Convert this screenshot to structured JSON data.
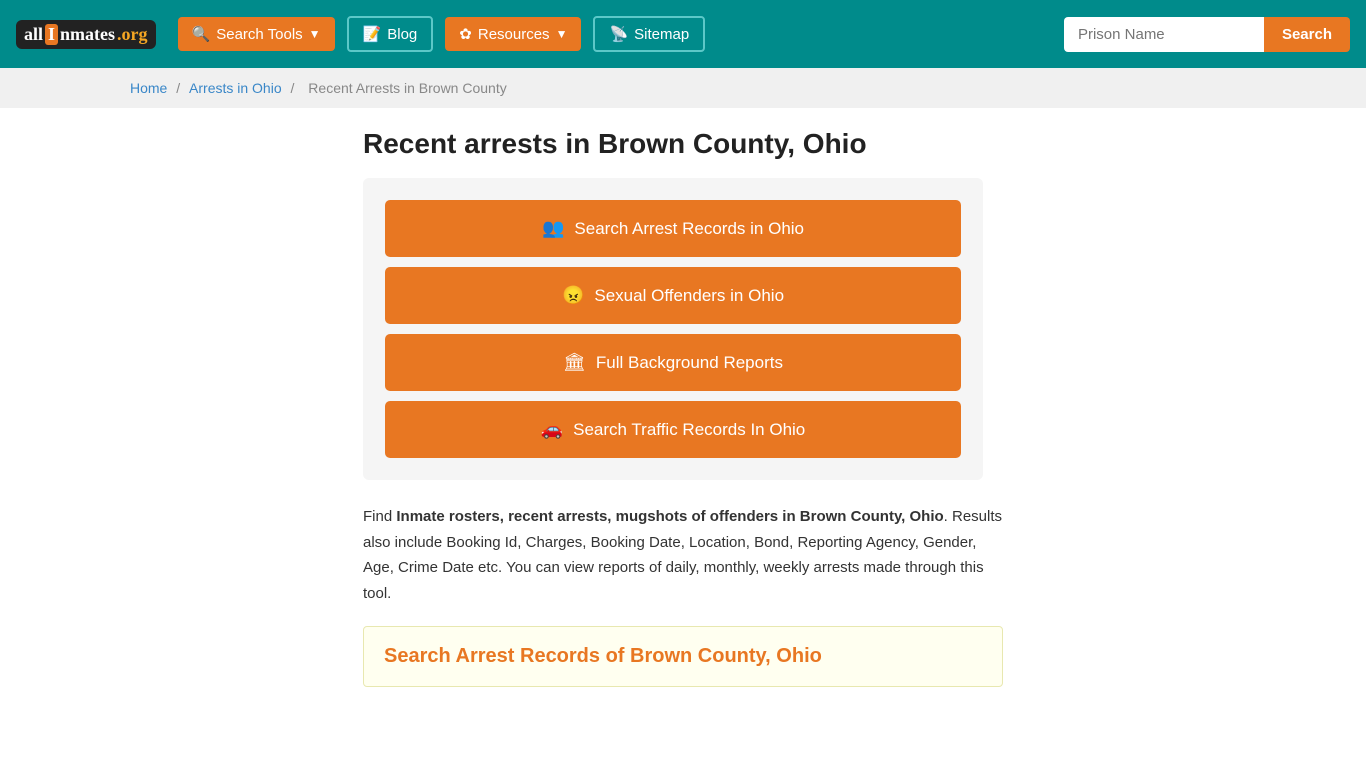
{
  "header": {
    "logo": {
      "all": "all",
      "i": "I",
      "nmates": "nmates",
      "dot_org": ".org"
    },
    "nav": {
      "search_tools_label": "Search Tools",
      "blog_label": "Blog",
      "resources_label": "Resources",
      "sitemap_label": "Sitemap"
    },
    "search": {
      "placeholder": "Prison Name",
      "button_label": "Search"
    }
  },
  "breadcrumb": {
    "home": "Home",
    "arrests_in_ohio": "Arrests in Ohio",
    "current": "Recent Arrests in Brown County"
  },
  "main": {
    "page_title": "Recent arrests in Brown County, Ohio",
    "action_buttons": [
      {
        "id": "search-arrest-records",
        "icon": "👥",
        "label": "Search Arrest Records in Ohio"
      },
      {
        "id": "sexual-offenders",
        "icon": "😠",
        "label": "Sexual Offenders in Ohio"
      },
      {
        "id": "full-background-reports",
        "icon": "🏛",
        "label": "Full Background Reports"
      },
      {
        "id": "search-traffic-records",
        "icon": "🚗",
        "label": "Search Traffic Records In Ohio"
      }
    ],
    "description": {
      "prefix": "Find ",
      "bold": "Inmate rosters, recent arrests, mugshots of offenders in Brown County, Ohio",
      "suffix": ". Results also include Booking Id, Charges, Booking Date, Location, Bond, Reporting Agency, Gender, Age, Crime Date etc. You can view reports of daily, monthly, weekly arrests made through this tool."
    },
    "search_section_title": "Search Arrest Records of Brown County, Ohio"
  }
}
